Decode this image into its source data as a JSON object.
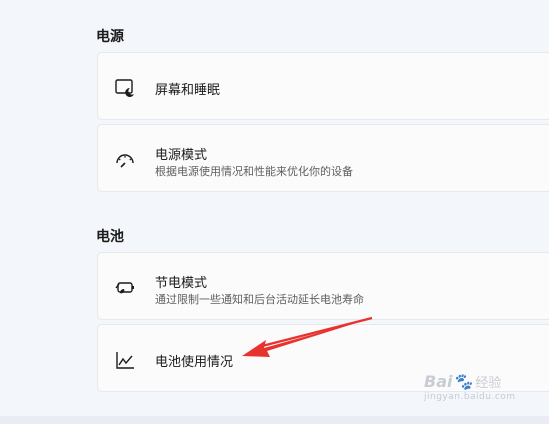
{
  "sections": {
    "power": {
      "title": "电源",
      "items": [
        {
          "title": "屏幕和睡眠",
          "icon": "screen-sleep-icon"
        },
        {
          "title": "电源模式",
          "description": "根据电源使用情况和性能来优化你的设备",
          "icon": "power-mode-gauge-icon"
        }
      ]
    },
    "battery": {
      "title": "电池",
      "items": [
        {
          "title": "节电模式",
          "description": "通过限制一些通知和后台活动延长电池寿命",
          "icon": "battery-saver-icon"
        },
        {
          "title": "电池使用情况",
          "icon": "battery-usage-chart-icon"
        }
      ]
    }
  },
  "annotation": {
    "arrow_color": "#e8322e"
  },
  "watermark": {
    "brand": "Bai",
    "suffix": "经验",
    "url": "jingyan.baidu.com"
  }
}
